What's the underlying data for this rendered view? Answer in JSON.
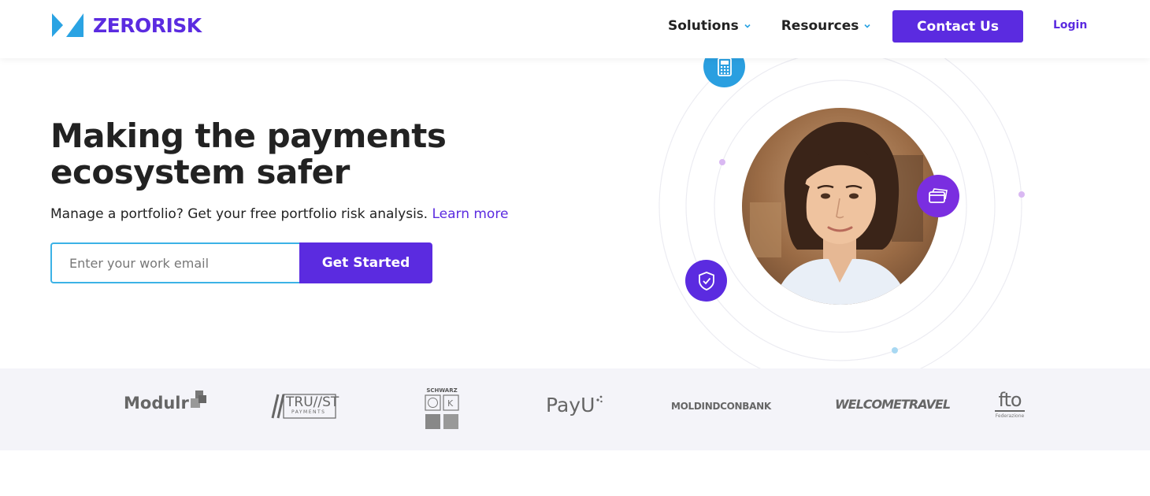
{
  "brand": {
    "name": "ZERORISK",
    "color": "#5b2be0",
    "logo_icon": "zerorisk-logo-icon"
  },
  "nav": {
    "items": [
      {
        "label": "Solutions",
        "icon": "chevron-down-icon"
      },
      {
        "label": "Resources",
        "icon": "chevron-down-icon"
      }
    ],
    "contact_label": "Contact Us",
    "login_label": "Login"
  },
  "hero": {
    "title_line1": "Making the payments",
    "title_line2": "ecosystem safer",
    "subtitle": "Manage a portfolio? Get your free portfolio risk analysis.",
    "learn_more": "Learn more",
    "email_placeholder": "Enter your work email",
    "cta_label": "Get Started"
  },
  "illustration": {
    "badges": [
      {
        "icon": "card-reader-icon",
        "color": "#2a9fe0"
      },
      {
        "icon": "credit-card-icon",
        "color": "#7a2ee0"
      },
      {
        "icon": "shield-check-icon",
        "color": "#5b2be0"
      }
    ],
    "portrait": "woman-portrait"
  },
  "partners": {
    "modulr": "Modulr",
    "trust": "TRU//ST",
    "trust_sub": "PAYMENTS",
    "schwarz": "SCHWARZ",
    "payu": "PayU",
    "moldind": "MOLDINDCONBANK",
    "welcome": "WELCOMETRAVEL",
    "fto": "fto",
    "fto_sub": "Federazione"
  }
}
